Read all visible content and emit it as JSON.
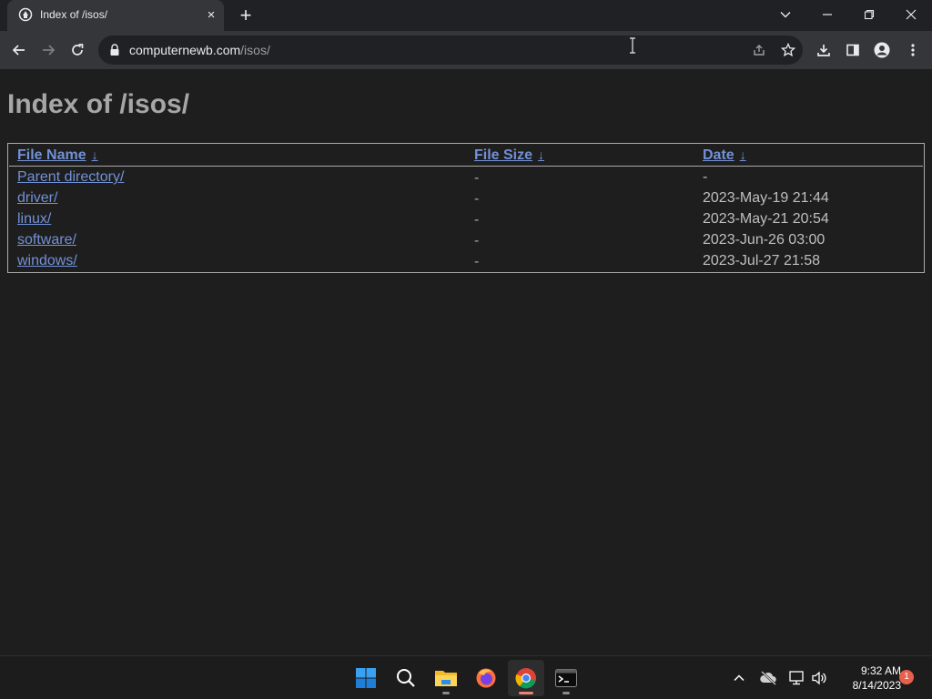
{
  "browser": {
    "tab_title": "Index of /isos/",
    "tab_close": "×",
    "new_tab": "+",
    "url_host": "computernewb.com",
    "url_path": "/isos/"
  },
  "page": {
    "heading": "Index of /isos/",
    "columns": {
      "name": "File Name",
      "size": "File Size",
      "date": "Date",
      "sort_indicator": "↓"
    },
    "rows": [
      {
        "name": "Parent directory/",
        "size": "-",
        "date": "-"
      },
      {
        "name": "driver/",
        "size": "-",
        "date": "2023-May-19 21:44"
      },
      {
        "name": "linux/",
        "size": "-",
        "date": "2023-May-21 20:54"
      },
      {
        "name": "software/",
        "size": "-",
        "date": "2023-Jun-26 03:00"
      },
      {
        "name": "windows/",
        "size": "-",
        "date": "2023-Jul-27 21:58"
      }
    ]
  },
  "taskbar": {
    "time": "9:32 AM",
    "date": "8/14/2023",
    "notification_count": "1",
    "apps": [
      "start-icon",
      "search-icon",
      "file-explorer-icon",
      "firefox-icon",
      "chrome-icon",
      "terminal-icon"
    ]
  },
  "colors": {
    "link": "#7291d6",
    "page_background": "#1e1e1e",
    "toolbar": "#35363a"
  }
}
